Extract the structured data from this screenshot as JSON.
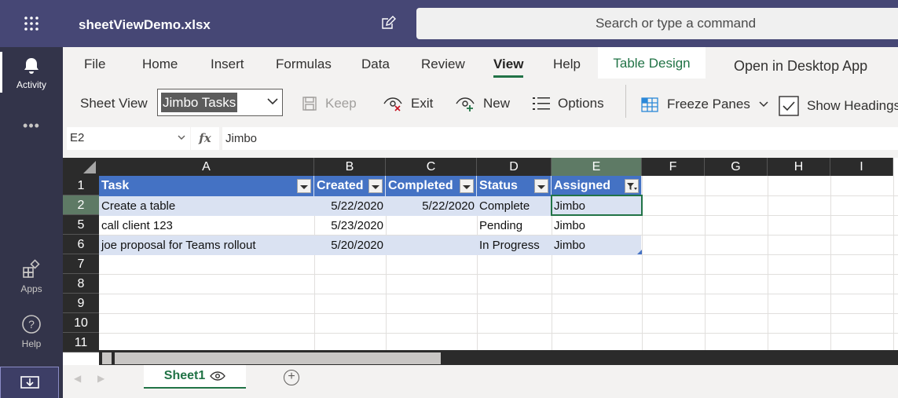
{
  "app": {
    "file_name": "sheetViewDemo.xlsx",
    "search_placeholder": "Search or type a command"
  },
  "rail": {
    "items": [
      {
        "label": "Activity",
        "icon": "bell-icon",
        "active": true
      },
      {
        "label": "Apps",
        "icon": "apps-icon"
      },
      {
        "label": "Help",
        "icon": "help-icon"
      }
    ],
    "more_label": "•••"
  },
  "ribbon": {
    "tabs": [
      "File",
      "Home",
      "Insert",
      "Formulas",
      "Data",
      "Review",
      "View",
      "Help"
    ],
    "active_tab": "View",
    "table_design_label": "Table Design",
    "open_desktop_label": "Open in Desktop App",
    "sheet_view_label": "Sheet View",
    "sheet_view_value": "Jimbo Tasks",
    "keep_label": "Keep",
    "exit_label": "Exit",
    "new_label": "New",
    "options_label": "Options",
    "freeze_panes_label": "Freeze Panes",
    "show_headings_label": "Show Headings"
  },
  "formula_bar": {
    "name_box": "E2",
    "fx": "fx",
    "formula": "Jimbo"
  },
  "grid": {
    "columns": [
      "A",
      "B",
      "C",
      "D",
      "E",
      "F",
      "G",
      "H",
      "I"
    ],
    "selected_column": "E",
    "row_numbers": [
      "1",
      "2",
      "5",
      "6",
      "7",
      "8",
      "9",
      "10",
      "11"
    ],
    "selected_row": "2",
    "headers": [
      "Task",
      "Created",
      "Completed",
      "Status",
      "Assigned"
    ],
    "rows": [
      [
        "Create a table",
        "5/22/2020",
        "5/22/2020",
        "Complete",
        "Jimbo"
      ],
      [
        "call client 123",
        "5/23/2020",
        "",
        "Pending",
        "Jimbo"
      ],
      [
        "joe proposal for Teams rollout",
        "5/20/2020",
        "",
        "In Progress",
        "Jimbo"
      ]
    ]
  },
  "sheets": {
    "active": "Sheet1"
  },
  "colors": {
    "teams_purple": "#464775",
    "excel_green": "#217346",
    "table_header_blue": "#4472c4",
    "band_blue": "#dae2f2"
  }
}
